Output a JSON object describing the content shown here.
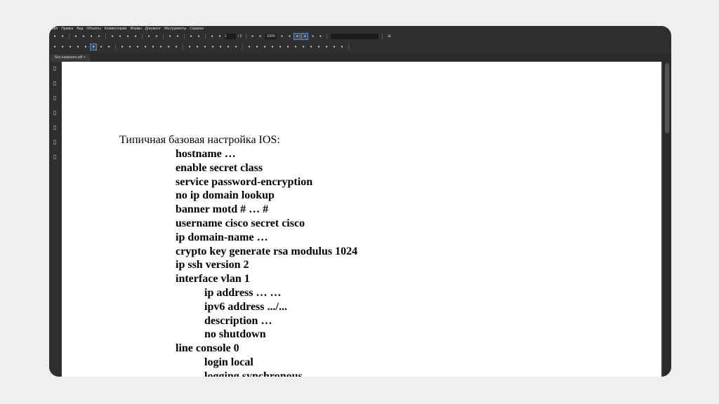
{
  "menu": [
    "Файл",
    "Правка",
    "Вид",
    "Объекты",
    "Комментарии",
    "Формы",
    "Документ",
    "Инструменты",
    "Справка"
  ],
  "toolbar1": {
    "icons_left": [
      "new-icon",
      "open-icon",
      "save-icon",
      "save-as-icon",
      "email-icon",
      "print-icon",
      "cut-icon",
      "copy-icon",
      "paste-icon",
      "delete-icon",
      "undo-icon",
      "redo-icon",
      "grid-icon",
      "snap-icon",
      "prev-icon",
      "next-icon",
      "up-icon",
      "down-icon"
    ],
    "page_current": "1",
    "page_total": "/ 2",
    "icons_right": [
      "fit-page-icon",
      "fit-width-icon"
    ],
    "zoom": "100%",
    "icons_after": [
      "actual-size-icon",
      "pan-icon",
      "marquee-icon",
      "hand-icon",
      "rotate-left-icon",
      "rotate-right-icon"
    ],
    "search_placeholder": "",
    "menu_icon": "hamburger-icon"
  },
  "toolbar2": {
    "icons": [
      "select-icon",
      "text-select-icon",
      "edit-text-icon",
      "edit-object-icon",
      "form-icon",
      "snapshot-icon",
      "crop-icon",
      "camera-icon",
      "link-icon",
      "button-icon",
      "checkbox-icon",
      "combo-icon",
      "list-icon",
      "radio-icon",
      "signature-icon",
      "stamp-icon",
      "typewriter-icon",
      "image-icon",
      "line-icon",
      "rect-icon",
      "polygon-icon",
      "pencil-icon",
      "eraser-icon",
      "highlight-icon",
      "check-icon",
      "attach-icon",
      "marker-icon",
      "line-tool-icon",
      "arrow-icon",
      "measure-icon",
      "sticky-icon",
      "callout-icon",
      "replace-icon",
      "sign-icon",
      "zoom-tool-icon",
      "approve-icon"
    ]
  },
  "tab": {
    "label": "Без названия.pdf"
  },
  "sidebar": [
    "pages-icon",
    "bookmarks-icon",
    "attachments-icon",
    "search-icon",
    "layers-icon",
    "fields-icon",
    "signatures-icon"
  ],
  "document": {
    "heading": "Типичная базовая настройка IOS:",
    "lines": [
      {
        "t": "hostname …",
        "i": 1
      },
      {
        "t": "enable secret class",
        "i": 1
      },
      {
        "t": "service password-encryption",
        "i": 1
      },
      {
        "t": "no ip domain lookup",
        "i": 1
      },
      {
        "t": "banner motd # … #",
        "i": 1
      },
      {
        "t": "username cisco secret cisco",
        "i": 1
      },
      {
        "t": "ip domain-name …",
        "i": 1
      },
      {
        "t": "crypto key generate rsa modulus 1024",
        "i": 1
      },
      {
        "t": "ip ssh version 2",
        "i": 1
      },
      {
        "t": "interface vlan 1",
        "i": 1
      },
      {
        "t": "ip address … …",
        "i": 2
      },
      {
        "t": "ipv6 address .../...",
        "i": 2
      },
      {
        "t": "description …",
        "i": 2
      },
      {
        "t": "no shutdown",
        "i": 2
      },
      {
        "t": "line console 0",
        "i": 1
      },
      {
        "t": "login local",
        "i": 2
      },
      {
        "t": "logging synchronous",
        "i": 2
      }
    ]
  }
}
